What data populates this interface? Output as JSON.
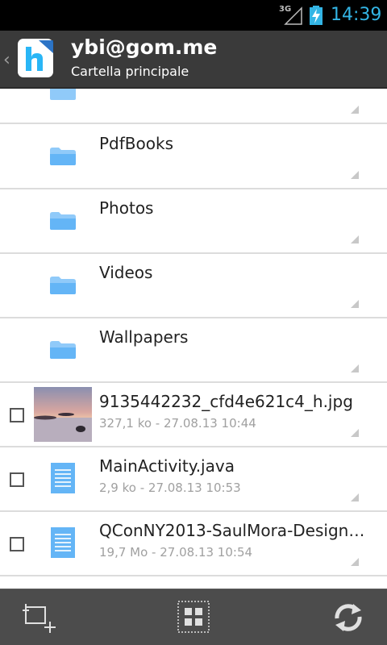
{
  "status_bar": {
    "network": "3G",
    "time": "14:39",
    "time_color": "#33b5e5"
  },
  "action_bar": {
    "title": "ybi@gom.me",
    "subtitle": "Cartella principale",
    "logo_color": "#1e88e5"
  },
  "folders": [
    {
      "name": ""
    },
    {
      "name": "PdfBooks"
    },
    {
      "name": "Photos"
    },
    {
      "name": "Videos"
    },
    {
      "name": "Wallpapers"
    }
  ],
  "files": [
    {
      "name": "9135442232_cfd4e621c4_h.jpg",
      "meta": "327,1 ko - 27.08.13 10:44",
      "icon": "image-thumbnail"
    },
    {
      "name": "MainActivity.java",
      "meta": "2,9 ko - 27.08.13 10:53",
      "icon": "document-icon"
    },
    {
      "name": "QConNY2013-SaulMora-Design…",
      "meta": "19,7 Mo - 27.08.13 10:54",
      "icon": "document-icon"
    }
  ],
  "bottom_bar": {
    "buttons": [
      "select-add-icon",
      "grid-view-icon",
      "refresh-icon"
    ]
  }
}
